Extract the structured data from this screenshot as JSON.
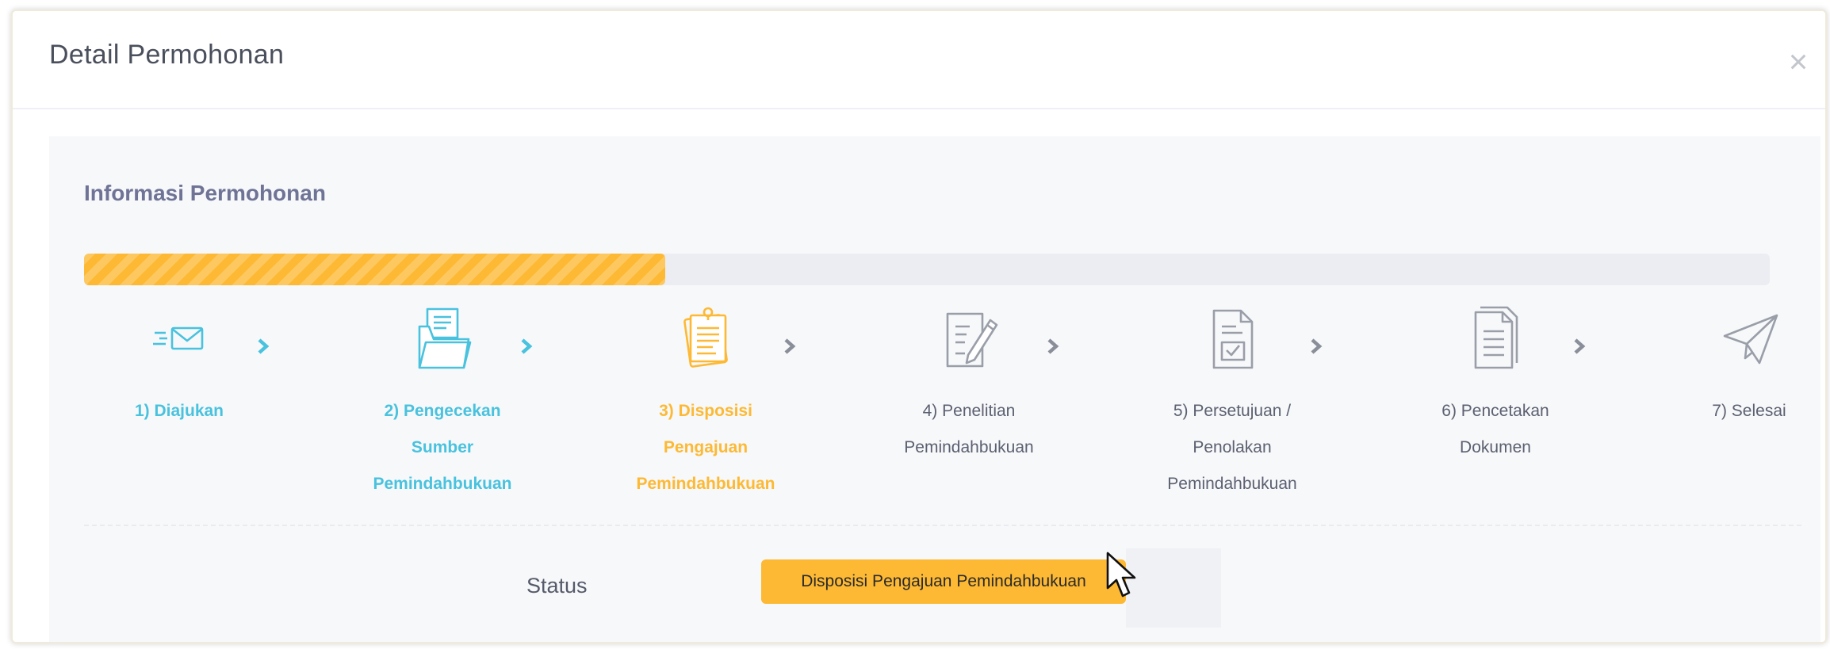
{
  "modal": {
    "title": "Detail Permohonan",
    "close_label": "×"
  },
  "section": {
    "title": "Informasi Permohonan"
  },
  "progress": {
    "value_fraction": 0.345,
    "color": "#fdb934",
    "track_color": "#ebedf2"
  },
  "steps": [
    {
      "label": "1) Diajukan",
      "state": "done",
      "icon": "envelope-icon"
    },
    {
      "label": "2) Pengecekan\nSumber\nPemindahbukuan",
      "state": "done",
      "icon": "folder-icon"
    },
    {
      "label": "3) Disposisi\nPengajuan\nPemindahbukuan",
      "state": "active",
      "icon": "notepad-icon"
    },
    {
      "label": "4) Penelitian\nPemindahbukuan",
      "state": "pending",
      "icon": "edit-document-icon"
    },
    {
      "label": "5) Persetujuan /\nPenolakan\nPemindahbukuan",
      "state": "pending",
      "icon": "check-document-icon"
    },
    {
      "label": "6) Pencetakan\nDokumen",
      "state": "pending",
      "icon": "print-document-icon"
    },
    {
      "label": "7) Selesai",
      "state": "pending",
      "icon": "paper-plane-icon"
    }
  ],
  "colors": {
    "done": "#49c2de",
    "active": "#fdb934",
    "pending": "#5c6070",
    "pending_icon": "#9a9ea8",
    "chevron_done": "#49c2de",
    "chevron_pending": "#8a8e99"
  },
  "status": {
    "label": "Status",
    "value": "Disposisi Pengajuan Pemindahbukuan"
  }
}
